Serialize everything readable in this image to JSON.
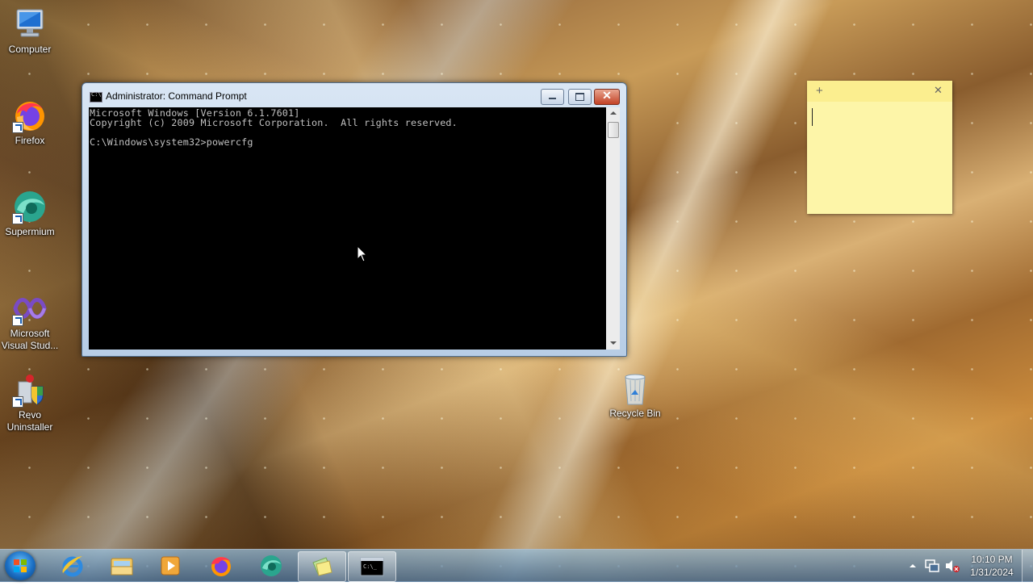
{
  "desktop": {
    "icons": [
      {
        "label": "Computer",
        "icon": "computer-icon"
      },
      {
        "label": "Firefox",
        "icon": "firefox-icon"
      },
      {
        "label": "Supermium",
        "icon": "supermium-icon"
      },
      {
        "label": "Microsoft Visual Stud...",
        "label_line1": "Microsoft",
        "label_line2": "Visual Stud...",
        "icon": "visual-studio-icon"
      },
      {
        "label_line1": "Revo",
        "label_line2": "Uninstaller",
        "icon": "revo-uninstaller-icon"
      },
      {
        "label": "Recycle Bin",
        "icon": "recycle-bin-icon"
      }
    ]
  },
  "cmd_window": {
    "title": "Administrator: Command Prompt",
    "lines": [
      "Microsoft Windows [Version 6.1.7601]",
      "Copyright (c) 2009 Microsoft Corporation.  All rights reserved.",
      "",
      "C:\\Windows\\system32>powercfg"
    ],
    "buttons": {
      "minimize": "minimize",
      "maximize": "maximize",
      "close": "✕"
    }
  },
  "sticky_note": {
    "add_label": "+",
    "close_label": "✕",
    "text": ""
  },
  "taskbar": {
    "pinned": [
      {
        "name": "internet-explorer",
        "icon": "ie-icon"
      },
      {
        "name": "windows-explorer",
        "icon": "folder-icon"
      },
      {
        "name": "media-player",
        "icon": "media-player-icon"
      },
      {
        "name": "firefox",
        "icon": "firefox-icon"
      },
      {
        "name": "supermium",
        "icon": "supermium-icon"
      },
      {
        "name": "sticky-notes",
        "icon": "sticky-notes-icon",
        "active": true
      },
      {
        "name": "command-prompt",
        "icon": "cmd-icon",
        "active": true
      }
    ],
    "tray": {
      "time": "10:10 PM",
      "date": "1/31/2024"
    }
  },
  "colors": {
    "cmd_text": "#c0c0c0",
    "sticky_bg": "#fdf5a8",
    "close_red": "#c34225"
  }
}
